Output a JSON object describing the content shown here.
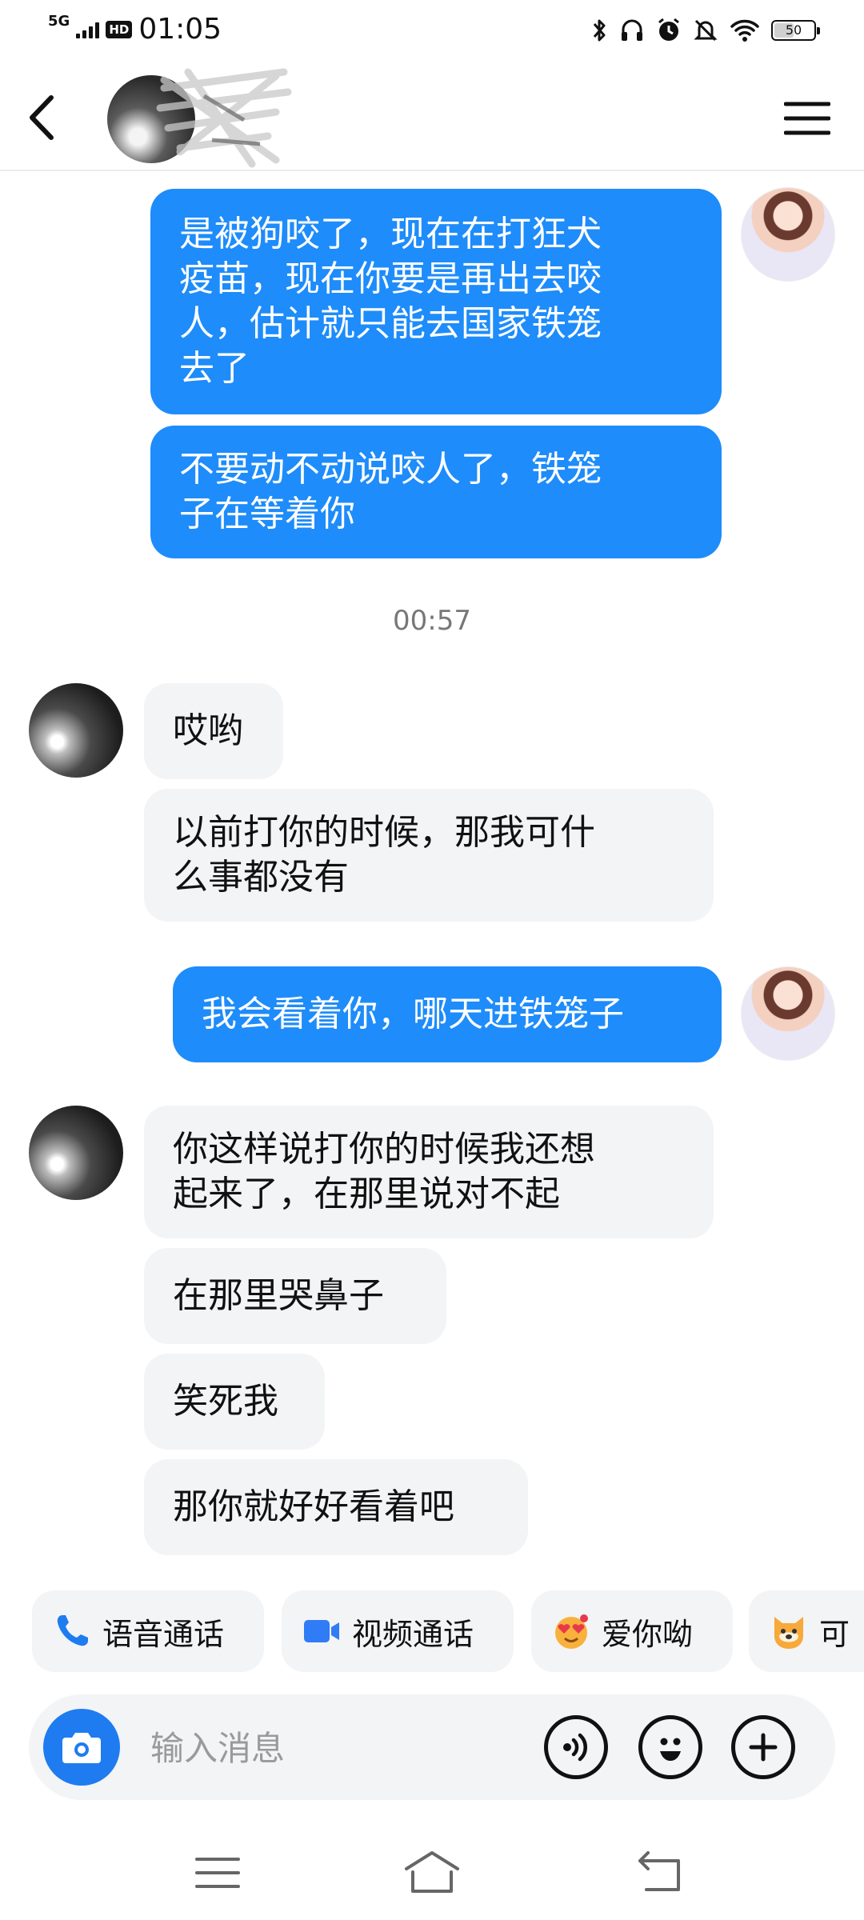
{
  "status_bar": {
    "network": "5G",
    "hd": "HD",
    "time": "01:05",
    "battery": "50",
    "battery_fraction": 0.5,
    "icons": [
      "bluetooth-icon",
      "headphones-icon",
      "alarm-icon",
      "mute-icon",
      "wifi-icon",
      "battery-icon"
    ]
  },
  "header": {
    "icons": [
      "back-arrow-icon",
      "contact-avatar",
      "menu-icon"
    ]
  },
  "messages": [
    {
      "from": "me",
      "lines": [
        "是被狗咬了，现在在打狂犬",
        "疫苗，现在你要是再出去咬",
        "人，估计就只能去国家铁笼",
        "去了"
      ]
    },
    {
      "from": "me",
      "lines": [
        "不要动不动说咬人了，铁笼",
        "子在等着你"
      ]
    },
    {
      "type": "timestamp",
      "text": "00:57"
    },
    {
      "from": "other",
      "lines": [
        "哎哟"
      ]
    },
    {
      "from": "other",
      "lines": [
        "以前打你的时候，那我可什",
        "么事都没有"
      ]
    },
    {
      "from": "me",
      "lines": [
        "我会看着你，哪天进铁笼子"
      ]
    },
    {
      "from": "other",
      "lines": [
        "你这样说打你的时候我还想",
        "起来了，在那里说对不起"
      ]
    },
    {
      "from": "other",
      "lines": [
        "在那里哭鼻子"
      ]
    },
    {
      "from": "other",
      "lines": [
        "笑死我"
      ]
    },
    {
      "from": "other",
      "lines": [
        "那你就好好看着吧"
      ]
    }
  ],
  "quick_actions": [
    {
      "label": "语音通话",
      "icon": "phone-icon",
      "color": "#1e7cf0"
    },
    {
      "label": "视频通话",
      "icon": "video-camera-icon",
      "color": "#2f7cf6"
    },
    {
      "label": "爱你呦",
      "icon": "heart-eyes-emoji-icon",
      "color": "#f5a623"
    },
    {
      "label": "可",
      "icon": "dog-emoji-icon",
      "color": "#f5a623"
    }
  ],
  "input": {
    "placeholder": "输入消息",
    "value": "",
    "icons": [
      "camera-icon",
      "voice-icon",
      "emoji-icon",
      "plus-icon"
    ]
  },
  "nav": {
    "icons": [
      "recent-apps-icon",
      "home-icon",
      "back-icon"
    ]
  },
  "colors": {
    "accent": "#1e8cfa",
    "bubble_other": "#f3f4f6",
    "text": "#111111"
  }
}
